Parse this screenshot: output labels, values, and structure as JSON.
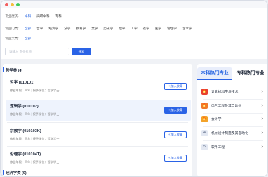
{
  "filters": {
    "level": {
      "label": "专业层次:",
      "options": [
        {
          "text": "本科",
          "active": true
        },
        {
          "text": "高职本科",
          "active": false
        },
        {
          "text": "专科",
          "active": false
        }
      ]
    },
    "category": {
      "label": "专业门类:",
      "options": [
        {
          "text": "全部",
          "active": true
        },
        {
          "text": "哲学",
          "active": false
        },
        {
          "text": "经济学",
          "active": false
        },
        {
          "text": "法学",
          "active": false
        },
        {
          "text": "教育学",
          "active": false
        },
        {
          "text": "文学",
          "active": false
        },
        {
          "text": "历史学",
          "active": false
        },
        {
          "text": "理学",
          "active": false
        },
        {
          "text": "工学",
          "active": false
        },
        {
          "text": "农学",
          "active": false
        },
        {
          "text": "医学",
          "active": false
        },
        {
          "text": "管理学",
          "active": false
        },
        {
          "text": "艺术学",
          "active": false
        }
      ]
    },
    "subject": {
      "label": "专业大类:",
      "options": [
        {
          "text": "全部",
          "active": true
        }
      ]
    },
    "search_placeholder": "请输入 专业名称",
    "search_button": "搜索"
  },
  "sections": [
    {
      "title": "哲学类 (4)"
    },
    {
      "title": "经济学类 (9)"
    }
  ],
  "majors": [
    {
      "name": "哲学 (010101)",
      "meta": "修业年限：四年  |  授予学位：哲学学士",
      "button": "+ 加入收藏",
      "highlight": false
    },
    {
      "name": "逻辑学 (010102)",
      "meta": "修业年限：四年  |  授予学位：哲学学士",
      "button": "+ 加入收藏",
      "highlight": true
    },
    {
      "name": "宗教学 (010103K)",
      "meta": "修业年限：四年  |  授予学位：哲学学士",
      "button": "+ 加入收藏",
      "highlight": false
    },
    {
      "name": "伦理学 (010104T)",
      "meta": "修业年限：四年  |  授予学位：哲学学士",
      "button": "+ 加入收藏",
      "highlight": false
    }
  ],
  "hot": {
    "tabs": [
      "本科热门专业",
      "专科热门专业"
    ],
    "items": [
      {
        "rank": "1",
        "name": "计算机科学与技术",
        "color": "#e8402f"
      },
      {
        "rank": "2",
        "name": "电气工程及其自动化",
        "color": "#f07a2a"
      },
      {
        "rank": "3",
        "name": "会计学",
        "color": "#f3a32a"
      },
      {
        "rank": "4",
        "name": "机械设计制造及其自动化",
        "color": "#8fa4c8"
      },
      {
        "rank": "5",
        "name": "软件工程",
        "color": "#8fa4c8"
      }
    ]
  }
}
